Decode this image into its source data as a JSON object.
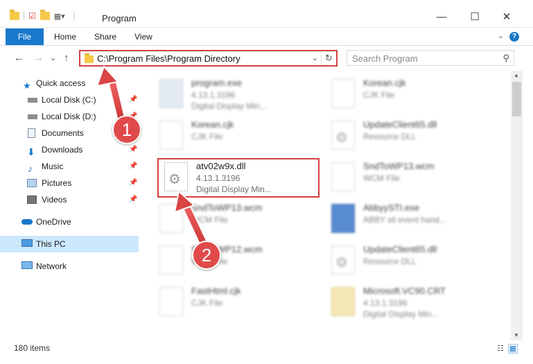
{
  "window": {
    "title": "Program",
    "minimize": "—",
    "maximize": "☐",
    "close": "✕"
  },
  "ribbon": {
    "tabs": [
      "File",
      "Home",
      "Share",
      "View"
    ],
    "help": "?",
    "collapse": "⌄"
  },
  "nav": {
    "back": "←",
    "forward": "→",
    "recent": "⌄",
    "up": "↑"
  },
  "address": {
    "path": "C:\\Program Files\\Program Directory",
    "dropdown": "⌄",
    "refresh": "↻"
  },
  "search": {
    "placeholder": "Search Program",
    "icon": "search-icon"
  },
  "sidebar": {
    "items": [
      {
        "label": "Quick access",
        "icon": "star-icon"
      },
      {
        "label": "Local Disk (C:)",
        "icon": "drive-icon"
      },
      {
        "label": "Local Disk (D:)",
        "icon": "drive-icon"
      },
      {
        "label": "Documents",
        "icon": "documents-icon"
      },
      {
        "label": "Downloads",
        "icon": "download-icon"
      },
      {
        "label": "Music",
        "icon": "music-icon"
      },
      {
        "label": "Pictures",
        "icon": "pictures-icon"
      },
      {
        "label": "Videos",
        "icon": "videos-icon"
      },
      {
        "label": "OneDrive",
        "icon": "cloud-icon"
      },
      {
        "label": "This PC",
        "icon": "computer-icon"
      },
      {
        "label": "Network",
        "icon": "network-icon"
      }
    ]
  },
  "files": {
    "left": [
      {
        "name": "program.exe",
        "line1": "4.13.1.3196",
        "line2": "Digital Display Min..."
      },
      {
        "name": "Korean.cjk",
        "line1": "CJK File",
        "line2": ""
      },
      {
        "name": "atv02w9x.dll",
        "line1": "4.13.1.3196",
        "line2": "Digital Display Min..."
      },
      {
        "name": "SndToWP13.wcm",
        "line1": "WCM File",
        "line2": ""
      },
      {
        "name": "SndToWP12.wcm",
        "line1": "WCM File",
        "line2": ""
      },
      {
        "name": "FastHtml.cjk",
        "line1": "CJK File",
        "line2": ""
      }
    ],
    "right": [
      {
        "name": "Korean.cjk",
        "line1": "CJK File",
        "line2": ""
      },
      {
        "name": "UpdateClient65.dll",
        "line1": "Resource DLL",
        "line2": ""
      },
      {
        "name": "SndToWP13.wcm",
        "line1": "WCM File",
        "line2": ""
      },
      {
        "name": "AbbyySTI.exe",
        "line1": "ABBY sti event hand...",
        "line2": ""
      },
      {
        "name": "UpdateClient65.dll",
        "line1": "Resource DLL",
        "line2": ""
      },
      {
        "name": "Microsoft.VC90.CRT",
        "line1": "4.13.1.3196",
        "line2": "Digital Display Min..."
      }
    ]
  },
  "status": {
    "count": "180 items"
  },
  "annotations": {
    "step1": "1",
    "step2": "2",
    "color": "#e04a4a"
  }
}
